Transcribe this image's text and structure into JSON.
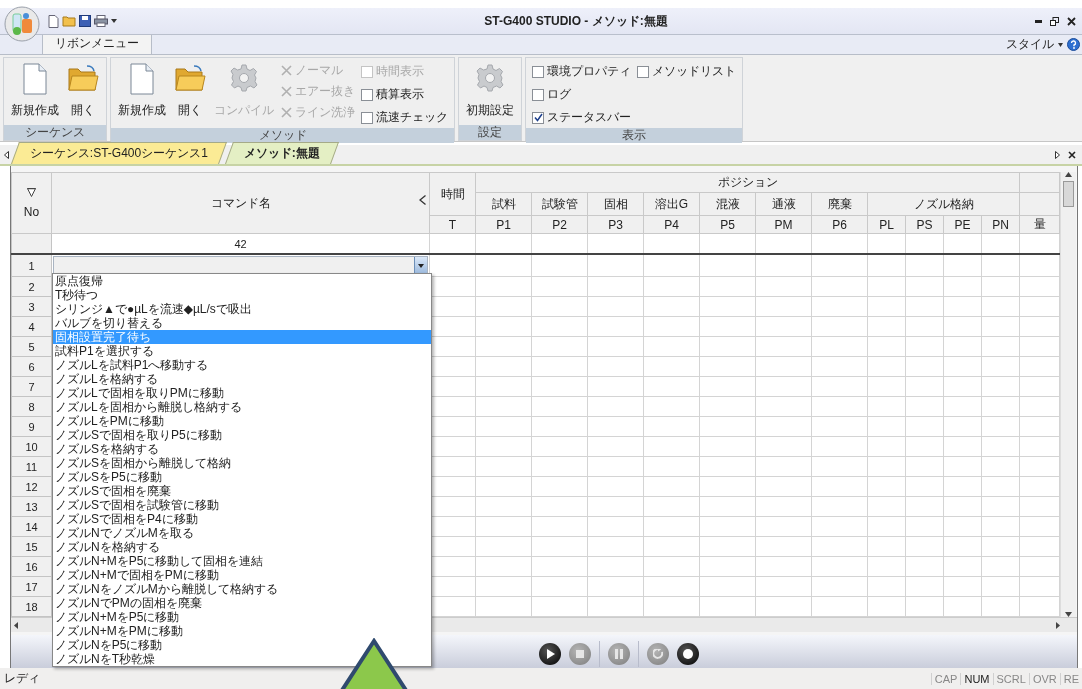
{
  "window": {
    "title": "ST-G400 STUDIO - メソッド:無題"
  },
  "ribbon_tabs": [
    {
      "label": "リボンメニュー",
      "selected": true
    }
  ],
  "style_menu": {
    "label": "スタイル"
  },
  "ribbon_groups": [
    {
      "title": "シーケンス",
      "columns": [
        [
          {
            "kind": "document",
            "label": "新規作成",
            "disabled": false
          }
        ],
        [
          {
            "kind": "folder",
            "label": "開く",
            "disabled": false
          }
        ]
      ]
    },
    {
      "title": "メソッド",
      "columns": [
        [
          {
            "kind": "document",
            "label": "新規作成",
            "disabled": false
          }
        ],
        [
          {
            "kind": "folder",
            "label": "開く",
            "disabled": false
          }
        ],
        [
          {
            "kind": "gear",
            "label": "コンパイル",
            "disabled": true
          }
        ],
        [
          {
            "kind": "cross",
            "label": "ノーマル",
            "disabled": true
          },
          {
            "kind": "cross",
            "label": "エアー抜き",
            "disabled": true
          },
          {
            "kind": "cross",
            "label": "ライン洗浄",
            "disabled": true
          }
        ],
        [
          {
            "kind": "checkbox",
            "label": "時間表示",
            "checked": false,
            "disabled": true
          },
          {
            "kind": "checkbox",
            "label": "積算表示",
            "checked": false,
            "disabled": false
          },
          {
            "kind": "checkbox",
            "label": "流速チェック",
            "checked": false,
            "disabled": false
          }
        ]
      ]
    },
    {
      "title": "設定",
      "columns": [
        [
          {
            "kind": "gear",
            "label": "初期設定",
            "disabled": false
          }
        ]
      ]
    },
    {
      "title": "表示",
      "columns": [
        [
          {
            "kind": "checkbox",
            "label": "環境プロパティ",
            "checked": false,
            "disabled": false
          },
          {
            "kind": "checkbox",
            "label": "ログ",
            "checked": false,
            "disabled": false
          },
          {
            "kind": "checkbox",
            "label": "ステータスバー",
            "checked": true,
            "disabled": false
          }
        ],
        [
          {
            "kind": "checkbox",
            "label": "メソッドリスト",
            "checked": false,
            "disabled": false
          }
        ]
      ]
    }
  ],
  "doc_tabs": [
    {
      "label": "シーケンス:ST-G400シーケンス1",
      "selected": false
    },
    {
      "label": "メソッド:無題",
      "selected": true
    }
  ],
  "grid": {
    "no_header": "No",
    "command_header": "コマンド名",
    "time_header": "時間",
    "time_code": "T",
    "position_header": "ポジション",
    "amount_code": "量",
    "command_count": "42",
    "position_groups": [
      {
        "label": "試料",
        "codes": [
          "P1"
        ]
      },
      {
        "label": "試験管",
        "codes": [
          "P2"
        ]
      },
      {
        "label": "固相",
        "codes": [
          "P3"
        ]
      },
      {
        "label": "溶出G",
        "codes": [
          "P4"
        ]
      },
      {
        "label": "混液",
        "codes": [
          "P5"
        ]
      },
      {
        "label": "通液",
        "codes": [
          "PM"
        ]
      },
      {
        "label": "廃棄",
        "codes": [
          "P6"
        ]
      },
      {
        "label": "ノズル格納",
        "codes": [
          "PL",
          "PS",
          "PE",
          "PN"
        ]
      }
    ],
    "rows": [
      "1",
      "2",
      "3",
      "4",
      "5",
      "6",
      "7",
      "8",
      "9",
      "10",
      "11",
      "12",
      "13",
      "14",
      "15",
      "16",
      "17",
      "18"
    ]
  },
  "dropdown": {
    "items": [
      {
        "label": "原点復帰",
        "selected": false
      },
      {
        "label": "T秒待つ",
        "selected": false
      },
      {
        "label": "シリンジ▲で●µLを流速◆µL/sで吸出",
        "selected": false
      },
      {
        "label": "バルブを切り替える",
        "selected": false
      },
      {
        "label": "固相設置完了待ち",
        "selected": true
      },
      {
        "label": "試料P1を選択する",
        "selected": false
      },
      {
        "label": "ノズルLを試料P1へ移動する",
        "selected": false
      },
      {
        "label": "ノズルLを格納する",
        "selected": false
      },
      {
        "label": "ノズルLで固相を取りPMに移動",
        "selected": false
      },
      {
        "label": "ノズルLを固相から離脱し格納する",
        "selected": false
      },
      {
        "label": "ノズルLをPMに移動",
        "selected": false
      },
      {
        "label": "ノズルSで固相を取りP5に移動",
        "selected": false
      },
      {
        "label": "ノズルSを格納する",
        "selected": false
      },
      {
        "label": "ノズルSを固相から離脱して格納",
        "selected": false
      },
      {
        "label": "ノズルSをP5に移動",
        "selected": false
      },
      {
        "label": "ノズルSで固相を廃棄",
        "selected": false
      },
      {
        "label": "ノズルSで固相を試験管に移動",
        "selected": false
      },
      {
        "label": "ノズルSで固相をP4に移動",
        "selected": false
      },
      {
        "label": "ノズルNでノズルMを取る",
        "selected": false
      },
      {
        "label": "ノズルNを格納する",
        "selected": false
      },
      {
        "label": "ノズルN+MをP5に移動して固相を連結",
        "selected": false
      },
      {
        "label": "ノズルN+Mで固相をPMに移動",
        "selected": false
      },
      {
        "label": "ノズルNをノズルMから離脱して格納する",
        "selected": false
      },
      {
        "label": "ノズルNでPMの固相を廃棄",
        "selected": false
      },
      {
        "label": "ノズルN+MをP5に移動",
        "selected": false
      },
      {
        "label": "ノズルN+MをPMに移動",
        "selected": false
      },
      {
        "label": "ノズルNをP5に移動",
        "selected": false
      },
      {
        "label": "ノズルNをT秒乾燥",
        "selected": false
      }
    ]
  },
  "player": [
    {
      "kind": "play",
      "disabled": false
    },
    {
      "kind": "stop",
      "disabled": true
    },
    {
      "kind": "pause",
      "disabled": true
    },
    {
      "kind": "reset",
      "disabled": true
    },
    {
      "kind": "record",
      "disabled": false
    }
  ],
  "status_bar": {
    "text": "レディ",
    "indicators": [
      {
        "label": "CAP",
        "on": false
      },
      {
        "label": "NUM",
        "on": true
      },
      {
        "label": "SCRL",
        "on": false
      },
      {
        "label": "OVR",
        "on": false
      },
      {
        "label": "RE",
        "on": false
      }
    ]
  }
}
